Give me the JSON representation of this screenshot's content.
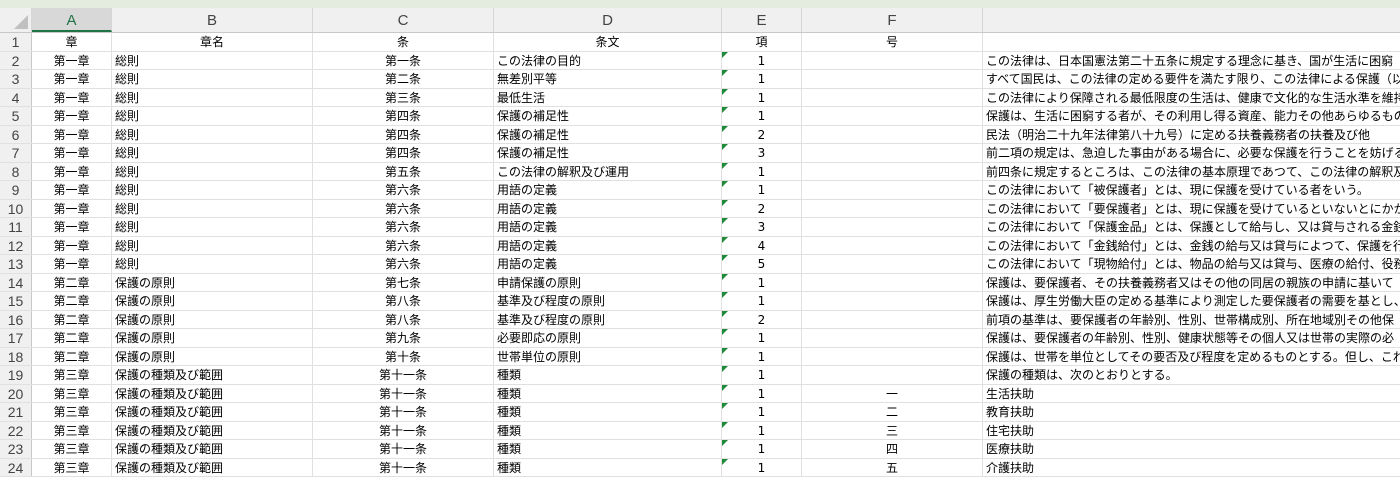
{
  "columns": [
    "A",
    "B",
    "C",
    "D",
    "E",
    "F",
    ""
  ],
  "header_row": {
    "num": "1",
    "cells": [
      "章",
      "章名",
      "条",
      "条文",
      "項",
      "号",
      ""
    ]
  },
  "rows": [
    [
      "2",
      "第一章",
      "総則",
      "第一条",
      "この法律の目的",
      "1",
      "",
      "この法律は、日本国憲法第二十五条に規定する理念に基き、国が生活に困窮"
    ],
    [
      "3",
      "第一章",
      "総則",
      "第二条",
      "無差別平等",
      "1",
      "",
      "すべて国民は、この法律の定める要件を満たす限り、この法律による保護（以下"
    ],
    [
      "4",
      "第一章",
      "総則",
      "第三条",
      "最低生活",
      "1",
      "",
      "この法律により保障される最低限度の生活は、健康で文化的な生活水準を維持"
    ],
    [
      "5",
      "第一章",
      "総則",
      "第四条",
      "保護の補足性",
      "1",
      "",
      "保護は、生活に困窮する者が、その利用し得る資産、能力その他あらゆるものを"
    ],
    [
      "6",
      "第一章",
      "総則",
      "第四条",
      "保護の補足性",
      "2",
      "",
      "民法（明治二十九年法律第八十九号）に定める扶養義務者の扶養及び他"
    ],
    [
      "7",
      "第一章",
      "総則",
      "第四条",
      "保護の補足性",
      "3",
      "",
      "前二項の規定は、急迫した事由がある場合に、必要な保護を行うことを妨げるも"
    ],
    [
      "8",
      "第一章",
      "総則",
      "第五条",
      "この法律の解釈及び運用",
      "1",
      "",
      "前四条に規定するところは、この法律の基本原理であつて、この法律の解釈及び"
    ],
    [
      "9",
      "第一章",
      "総則",
      "第六条",
      "用語の定義",
      "1",
      "",
      "この法律において「被保護者」とは、現に保護を受けている者をいう。"
    ],
    [
      "10",
      "第一章",
      "総則",
      "第六条",
      "用語の定義",
      "2",
      "",
      "この法律において「要保護者」とは、現に保護を受けているといないとにかかわらず"
    ],
    [
      "11",
      "第一章",
      "総則",
      "第六条",
      "用語の定義",
      "3",
      "",
      "この法律において「保護金品」とは、保護として給与し、又は貸与される金銭及び"
    ],
    [
      "12",
      "第一章",
      "総則",
      "第六条",
      "用語の定義",
      "4",
      "",
      "この法律において「金銭給付」とは、金銭の給与又は貸与によつて、保護を行うこ"
    ],
    [
      "13",
      "第一章",
      "総則",
      "第六条",
      "用語の定義",
      "5",
      "",
      "この法律において「現物給付」とは、物品の給与又は貸与、医療の給付、役務の"
    ],
    [
      "14",
      "第二章",
      "保護の原則",
      "第七条",
      "申請保護の原則",
      "1",
      "",
      "保護は、要保護者、その扶養義務者又はその他の同居の親族の申請に基いて"
    ],
    [
      "15",
      "第二章",
      "保護の原則",
      "第八条",
      "基準及び程度の原則",
      "1",
      "",
      "保護は、厚生労働大臣の定める基準により測定した要保護者の需要を基とし、"
    ],
    [
      "16",
      "第二章",
      "保護の原則",
      "第八条",
      "基準及び程度の原則",
      "2",
      "",
      "前項の基準は、要保護者の年齢別、性別、世帯構成別、所在地域別その他保"
    ],
    [
      "17",
      "第二章",
      "保護の原則",
      "第九条",
      "必要即応の原則",
      "1",
      "",
      "保護は、要保護者の年齢別、性別、健康状態等その個人又は世帯の実際の必"
    ],
    [
      "18",
      "第二章",
      "保護の原則",
      "第十条",
      "世帯単位の原則",
      "1",
      "",
      "保護は、世帯を単位としてその要否及び程度を定めるものとする。但し、これによ"
    ],
    [
      "19",
      "第三章",
      "保護の種類及び範囲",
      "第十一条",
      "種類",
      "1",
      "",
      "保護の種類は、次のとおりとする。"
    ],
    [
      "20",
      "第三章",
      "保護の種類及び範囲",
      "第十一条",
      "種類",
      "1",
      "一",
      "生活扶助"
    ],
    [
      "21",
      "第三章",
      "保護の種類及び範囲",
      "第十一条",
      "種類",
      "1",
      "二",
      "教育扶助"
    ],
    [
      "22",
      "第三章",
      "保護の種類及び範囲",
      "第十一条",
      "種類",
      "1",
      "三",
      "住宅扶助"
    ],
    [
      "23",
      "第三章",
      "保護の種類及び範囲",
      "第十一条",
      "種類",
      "1",
      "四",
      "医療扶助"
    ],
    [
      "24",
      "第三章",
      "保護の種類及び範囲",
      "第十一条",
      "種類",
      "1",
      "五",
      "介護扶助"
    ]
  ]
}
